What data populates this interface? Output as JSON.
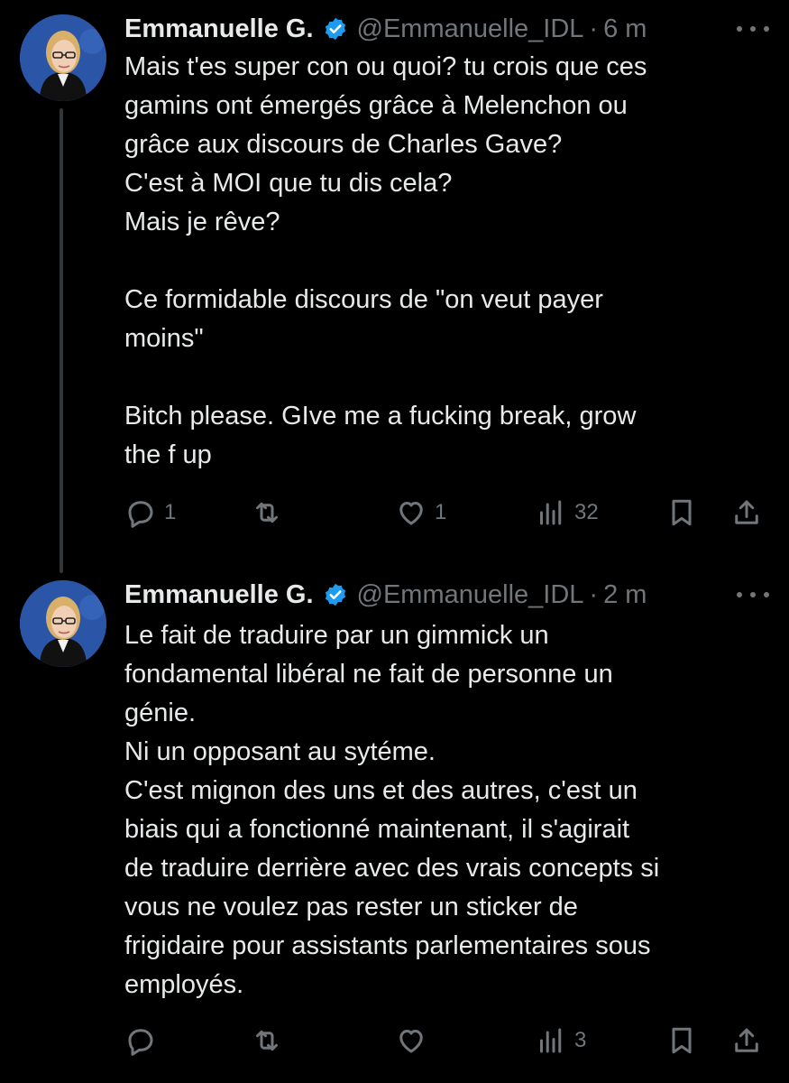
{
  "tweets": [
    {
      "author_name": "Emmanuelle G.",
      "handle": "@Emmanuelle_IDL",
      "separator": "·",
      "time": "6 m",
      "lines": [
        "Mais t'es super con ou quoi? tu crois que ces",
        "gamins ont émergés grâce à Melenchon ou",
        "grâce aux discours de Charles Gave?",
        "C'est à MOI que tu dis cela?",
        "Mais je rêve?",
        "",
        "Ce formidable discours de \"on veut payer",
        "moins\"",
        "",
        "Bitch please. GIve me a fucking break, grow",
        "the f up"
      ],
      "replies": "1",
      "retweets": "",
      "likes": "1",
      "views": "32"
    },
    {
      "author_name": "Emmanuelle G.",
      "handle": "@Emmanuelle_IDL",
      "separator": "·",
      "time": "2 m",
      "lines": [
        "Le fait de traduire par un gimmick un",
        "fondamental libéral ne fait de personne un",
        "génie.",
        "Ni un opposant au sytéme.",
        "C'est mignon des uns et des autres, c'est un",
        "biais qui a fonctionné maintenant, il s'agirait",
        "de traduire derrière avec des vrais concepts si",
        "vous ne voulez pas rester un sticker de",
        "frigidaire pour assistants parlementaires sous",
        "employés."
      ],
      "replies": "",
      "retweets": "",
      "likes": "",
      "views": "3"
    }
  ],
  "colors": {
    "background": "#000000",
    "text": "#e7e9ea",
    "muted": "#71767b",
    "verified": "#1d9bf0",
    "thread_line": "#333639"
  },
  "icons": [
    "reply-icon",
    "retweet-icon",
    "like-icon",
    "views-icon",
    "bookmark-icon",
    "share-icon",
    "verified-badge-icon",
    "more-icon"
  ]
}
